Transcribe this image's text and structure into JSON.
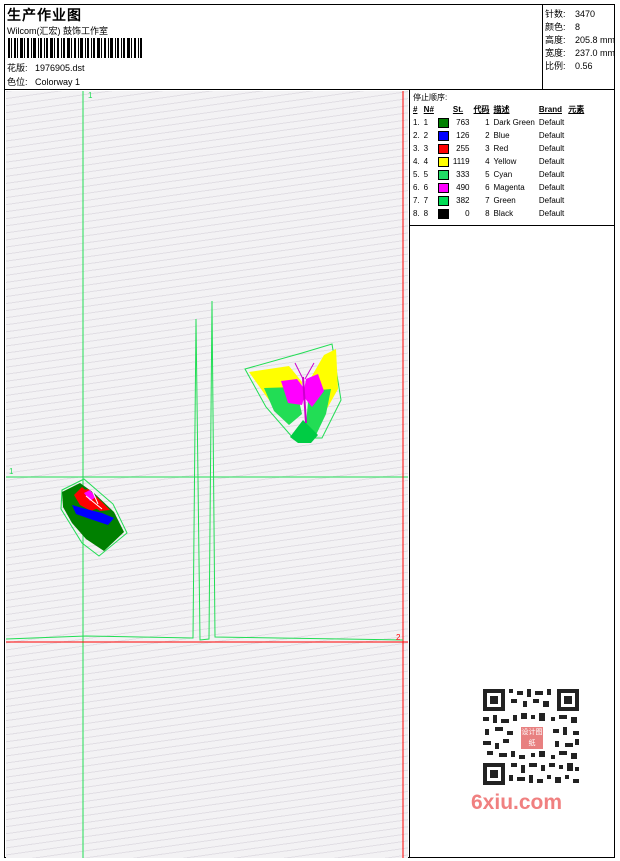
{
  "header": {
    "title": "生产作业图",
    "company": "Wilcom(汇宏) 鼓饰工作室",
    "design_label": "花版:",
    "design_value": "1976905.dst",
    "colorway_label": "色位:",
    "colorway_value": "Colorway 1"
  },
  "stats": [
    {
      "label": "针数:",
      "value": "3470"
    },
    {
      "label": "颜色:",
      "value": "8"
    },
    {
      "label": "高度:",
      "value": "205.8 mm"
    },
    {
      "label": "宽度:",
      "value": "237.0 mm"
    },
    {
      "label": "比例:",
      "value": "0.56"
    }
  ],
  "stop_sequence": {
    "title": "停止顺序:",
    "columns": [
      "#",
      "N#",
      "St.",
      "代码",
      "描述",
      "Brand",
      "元素"
    ],
    "rows": [
      {
        "idx": "1.",
        "n": "1",
        "color": "#008000",
        "st": "763",
        "code": "1",
        "desc": "Dark Green",
        "brand": "Default"
      },
      {
        "idx": "2.",
        "n": "2",
        "color": "#0000ff",
        "st": "126",
        "code": "2",
        "desc": "Blue",
        "brand": "Default"
      },
      {
        "idx": "3.",
        "n": "3",
        "color": "#ff0000",
        "st": "255",
        "code": "3",
        "desc": "Red",
        "brand": "Default"
      },
      {
        "idx": "4.",
        "n": "4",
        "color": "#ffff00",
        "st": "1119",
        "code": "4",
        "desc": "Yellow",
        "brand": "Default"
      },
      {
        "idx": "5.",
        "n": "5",
        "color": "#22dd66",
        "st": "333",
        "code": "5",
        "desc": "Cyan",
        "brand": "Default"
      },
      {
        "idx": "6.",
        "n": "6",
        "color": "#ff00ff",
        "st": "490",
        "code": "6",
        "desc": "Magenta",
        "brand": "Default"
      },
      {
        "idx": "7.",
        "n": "7",
        "color": "#00dd55",
        "st": "382",
        "code": "7",
        "desc": "Green",
        "brand": "Default"
      },
      {
        "idx": "8.",
        "n": "8",
        "color": "#000000",
        "st": "0",
        "code": "8",
        "desc": "Black",
        "brand": "Default"
      }
    ]
  },
  "canvas": {
    "markers": {
      "top": "1",
      "left": "1",
      "right": "2"
    },
    "guide_color": "#00cc44",
    "axis_color": "#ff0000"
  },
  "watermark": {
    "text": "6xiu.com",
    "stamp": "设计图纸"
  }
}
